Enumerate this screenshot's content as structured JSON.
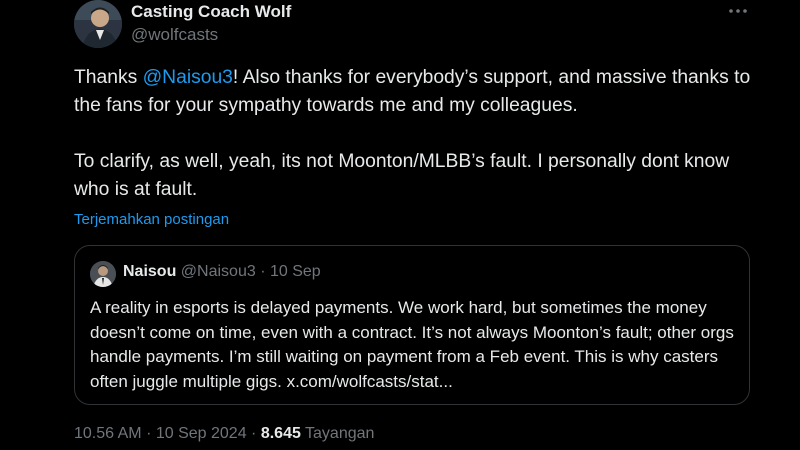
{
  "author": {
    "display_name": "Casting Coach Wolf",
    "handle": "@wolfcasts"
  },
  "tweet": {
    "p1_prefix": "Thanks ",
    "p1_mention": "@Naisou3",
    "p1_suffix": "! Also thanks for everybody’s support, and massive thanks to the fans for your sympathy towards me and my colleagues.",
    "p2": "To clarify, as well, yeah, its not Moonton/MLBB’s fault. I personally dont know who is at fault.",
    "translate_label": "Terjemahkan postingan"
  },
  "quote": {
    "name": "Naisou",
    "handle": "@Naisou3",
    "separator": "·",
    "date": "10 Sep",
    "text": "A reality in esports is delayed payments. We work hard, but sometimes the money doesn’t come on time, even with a contract. It’s not always Moonton’s fault; other orgs handle payments. I’m still waiting on payment from a Feb event. This is why casters often juggle multiple gigs. x.com/wolfcasts/stat..."
  },
  "meta": {
    "time": "10.56 AM",
    "separator": "·",
    "date": "10 Sep 2024",
    "views_count": "8.645",
    "views_label": "Tayangan"
  },
  "icons": {
    "more": "more-horizontal-icon"
  },
  "colors": {
    "background": "#000000",
    "text_primary": "#e7e9ea",
    "text_secondary": "#71767b",
    "accent": "#1d9bf0",
    "border": "#2f3336"
  }
}
